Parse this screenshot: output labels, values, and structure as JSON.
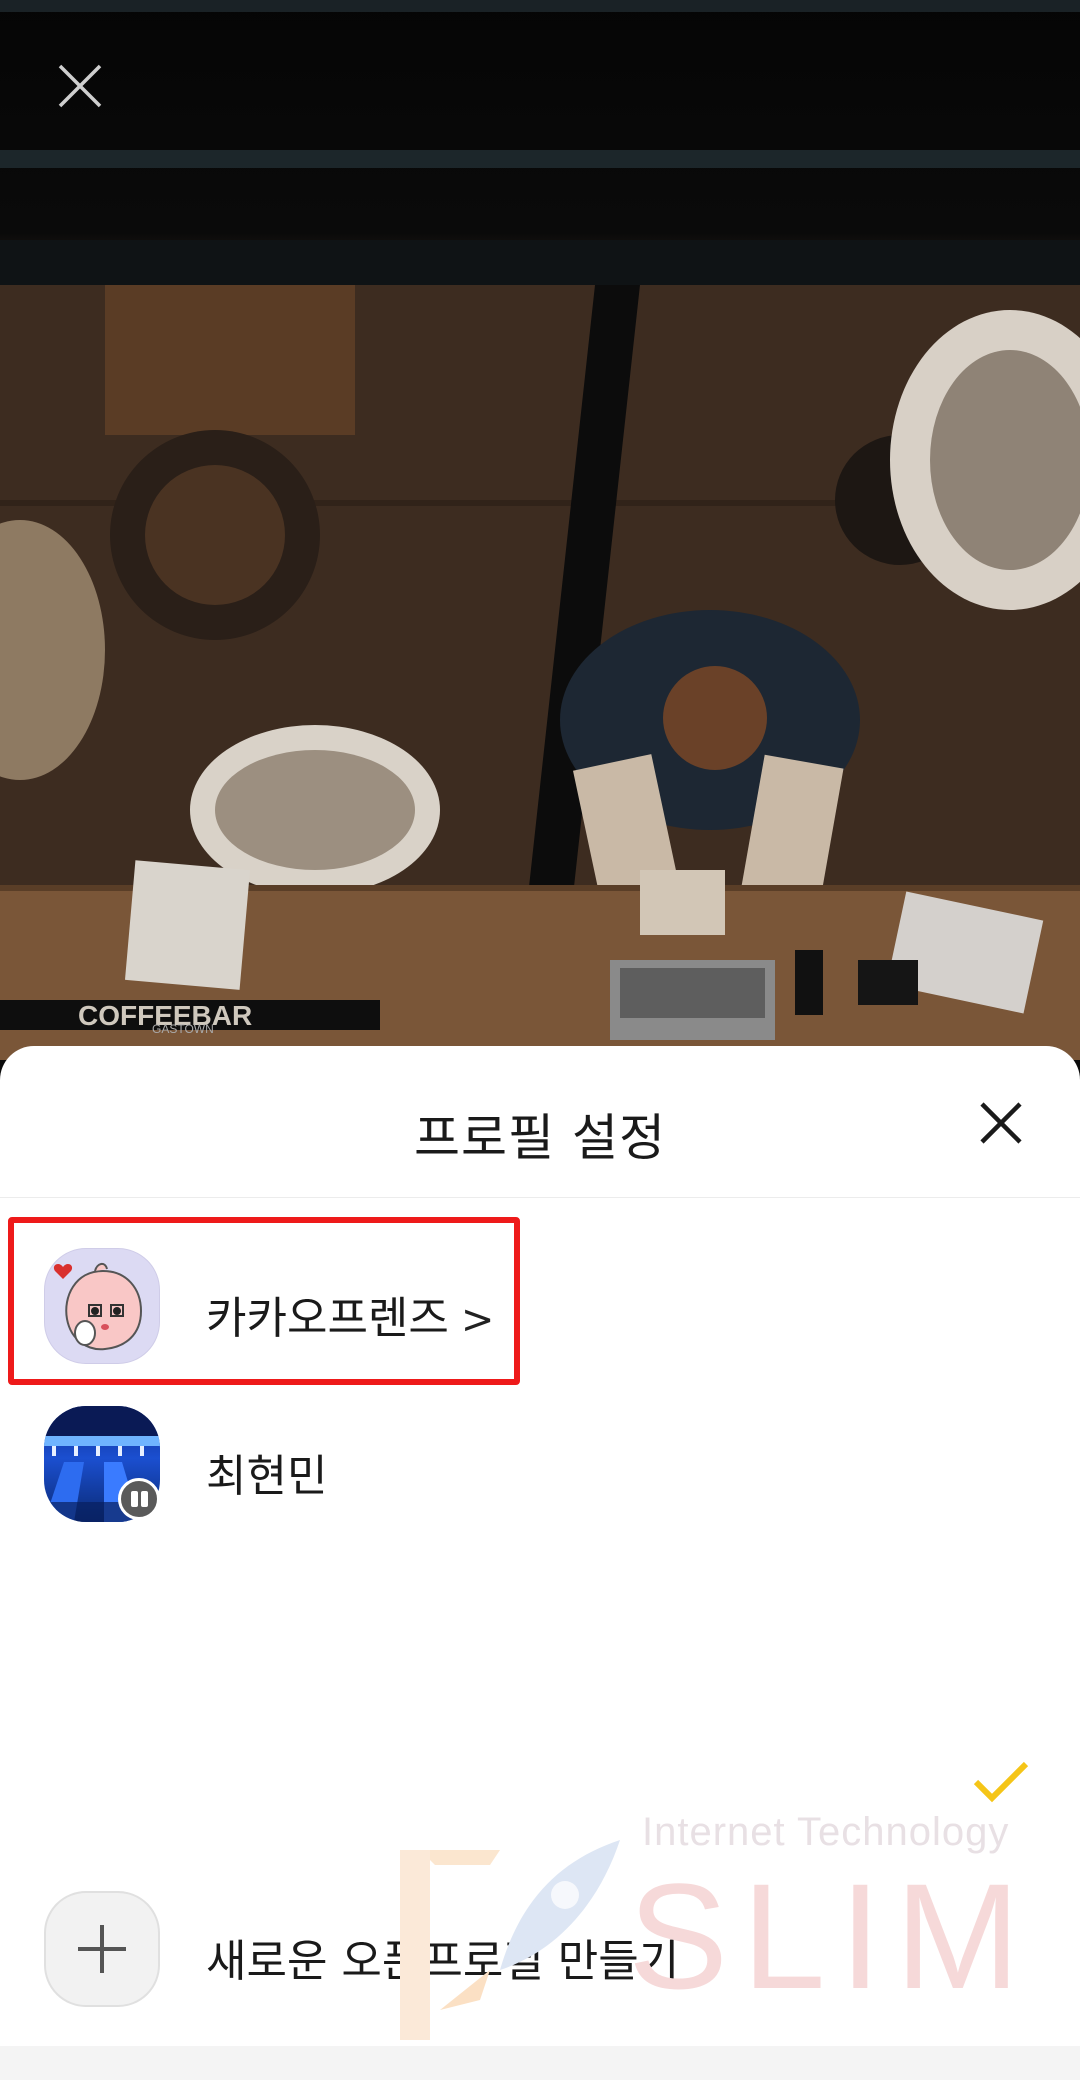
{
  "background": {
    "image": "coffee-bar-top-down-photo",
    "sign_text": "COFFEEBAR",
    "sign_sub": "GASTOWN",
    "close_icon": "close-icon"
  },
  "sheet": {
    "title": "프로필 설정",
    "close_icon": "close-icon",
    "profiles": [
      {
        "name": "카카오프렌즈",
        "chevron": ">",
        "icon": "kakao-friends-avatar",
        "selected": true
      },
      {
        "name": "최현민",
        "icon": "bowling-alley-avatar",
        "badge_icon": "pause-icon"
      }
    ],
    "check_icon": "checkmark-icon",
    "create": {
      "label": "새로운 오픈프로필 만들기",
      "icon": "plus-icon"
    }
  },
  "watermark": {
    "line1": "Internet Technology",
    "line2": "SLIM"
  },
  "colors": {
    "highlight": "#ee1a1a",
    "check": "#f5c518",
    "sheet_bg": "#ffffff"
  }
}
